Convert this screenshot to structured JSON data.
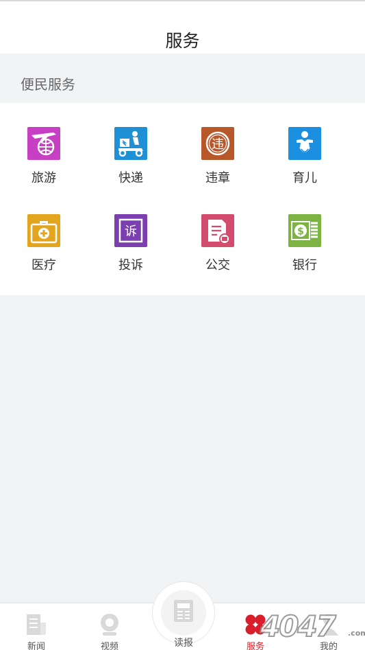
{
  "header": {
    "title": "服务"
  },
  "section": {
    "title": "便民服务"
  },
  "services": [
    {
      "label": "旅游",
      "icon": "plane-globe-icon",
      "color": "#c740c3"
    },
    {
      "label": "快递",
      "icon": "delivery-scooter-icon",
      "color": "#1f8fd6"
    },
    {
      "label": "违章",
      "icon": "violation-stamp-icon",
      "color": "#b8572a"
    },
    {
      "label": "育儿",
      "icon": "baby-icon",
      "color": "#1c8fe0"
    },
    {
      "label": "医疗",
      "icon": "medical-kit-icon",
      "color": "#e4a51e"
    },
    {
      "label": "投诉",
      "icon": "complaint-icon",
      "color": "#7b3fb0"
    },
    {
      "label": "公交",
      "icon": "bus-card-icon",
      "color": "#d34b6d"
    },
    {
      "label": "银行",
      "icon": "bank-money-icon",
      "color": "#7cb342"
    }
  ],
  "tabbar": {
    "items": [
      {
        "label": "新闻",
        "icon": "news-icon"
      },
      {
        "label": "视频",
        "icon": "video-icon"
      },
      {
        "label": "读报",
        "icon": "newspaper-icon"
      },
      {
        "label": "服务",
        "icon": "service-clover-icon",
        "active": true
      },
      {
        "label": "我的",
        "icon": "profile-icon"
      }
    ],
    "active_color": "#d81e2a"
  },
  "watermark": {
    "text": "4047",
    "suffix": ".com"
  }
}
